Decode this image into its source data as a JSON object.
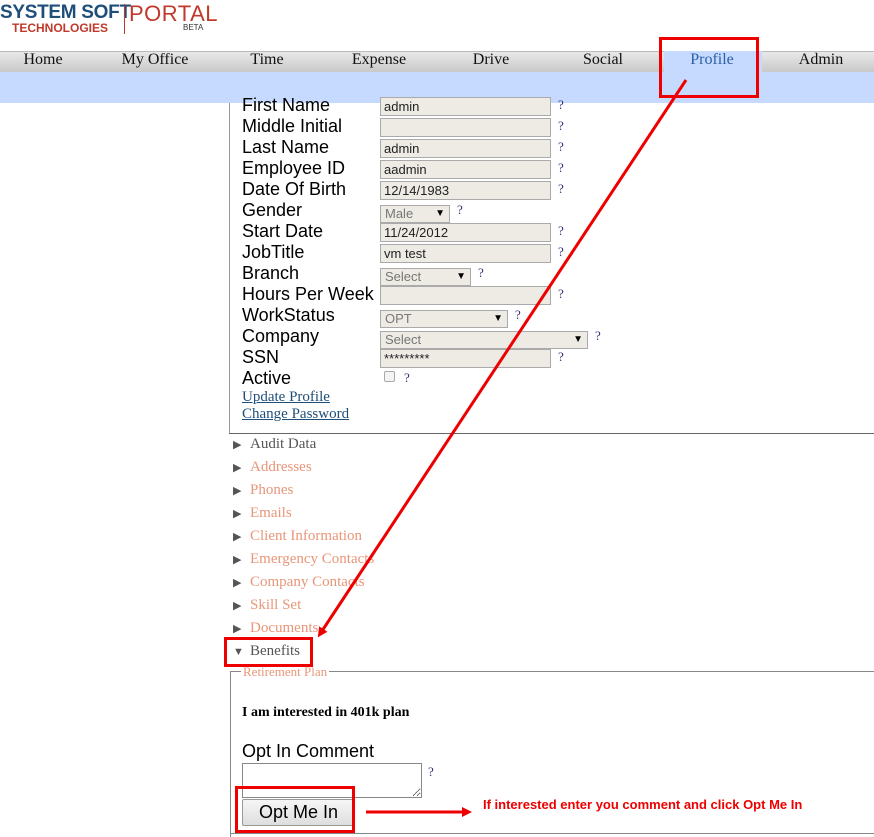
{
  "logo": {
    "line1": "SYSTEM SOFT",
    "line2": "TECHNOLOGIES",
    "portal": "PORTAL",
    "beta": "BETA"
  },
  "nav": [
    "Home",
    "My Office",
    "Time",
    "Expense",
    "Drive",
    "Social",
    "Profile",
    "Admin"
  ],
  "nav_active": "Profile",
  "form": {
    "fields": [
      {
        "label": "First Name",
        "value": "admin",
        "type": "text"
      },
      {
        "label": "Middle Initial",
        "value": "",
        "type": "text"
      },
      {
        "label": "Last Name",
        "value": "admin",
        "type": "text"
      },
      {
        "label": "Employee ID",
        "value": "aadmin",
        "type": "text"
      },
      {
        "label": "Date Of Birth",
        "value": "12/14/1983",
        "type": "text"
      },
      {
        "label": "Gender",
        "value": "Male",
        "type": "select"
      },
      {
        "label": "Start Date",
        "value": "11/24/2012",
        "type": "text"
      },
      {
        "label": "JobTitle",
        "value": "vm test",
        "type": "text"
      },
      {
        "label": "Branch",
        "value": "Select",
        "type": "select"
      },
      {
        "label": "Hours Per Week",
        "value": "",
        "type": "text"
      },
      {
        "label": "WorkStatus",
        "value": "OPT",
        "type": "select"
      },
      {
        "label": "Company",
        "value": "Select",
        "type": "select"
      },
      {
        "label": "SSN",
        "value": "*********",
        "type": "text"
      },
      {
        "label": "Active",
        "value": "",
        "type": "checkbox"
      }
    ],
    "help_mark": "?",
    "links": {
      "update": "Update Profile",
      "change_password": "Change Password"
    }
  },
  "sections": [
    {
      "label": "Audit Data",
      "expanded": false
    },
    {
      "label": "Addresses",
      "expanded": false
    },
    {
      "label": "Phones",
      "expanded": false
    },
    {
      "label": "Emails",
      "expanded": false
    },
    {
      "label": "Client Information",
      "expanded": false
    },
    {
      "label": "Emergency Contacts",
      "expanded": false
    },
    {
      "label": "Company Contacts",
      "expanded": false
    },
    {
      "label": "Skill Set",
      "expanded": false
    },
    {
      "label": "Documents",
      "expanded": false
    },
    {
      "label": "Benefits",
      "expanded": true
    }
  ],
  "benefits": {
    "legend": "Retirement Plan",
    "interest_text": "I am interested in 401k plan",
    "opt_in_label": "Opt In Comment",
    "opt_in_value": "",
    "button": "Opt Me In",
    "help_mark": "?"
  },
  "annotation": {
    "note": "If interested enter you comment and click Opt Me In",
    "color": "#e00000"
  },
  "colors": {
    "nav_active": "#2b5fa6",
    "subbar": "#c6d9ff",
    "section_link": "#e8967a"
  }
}
